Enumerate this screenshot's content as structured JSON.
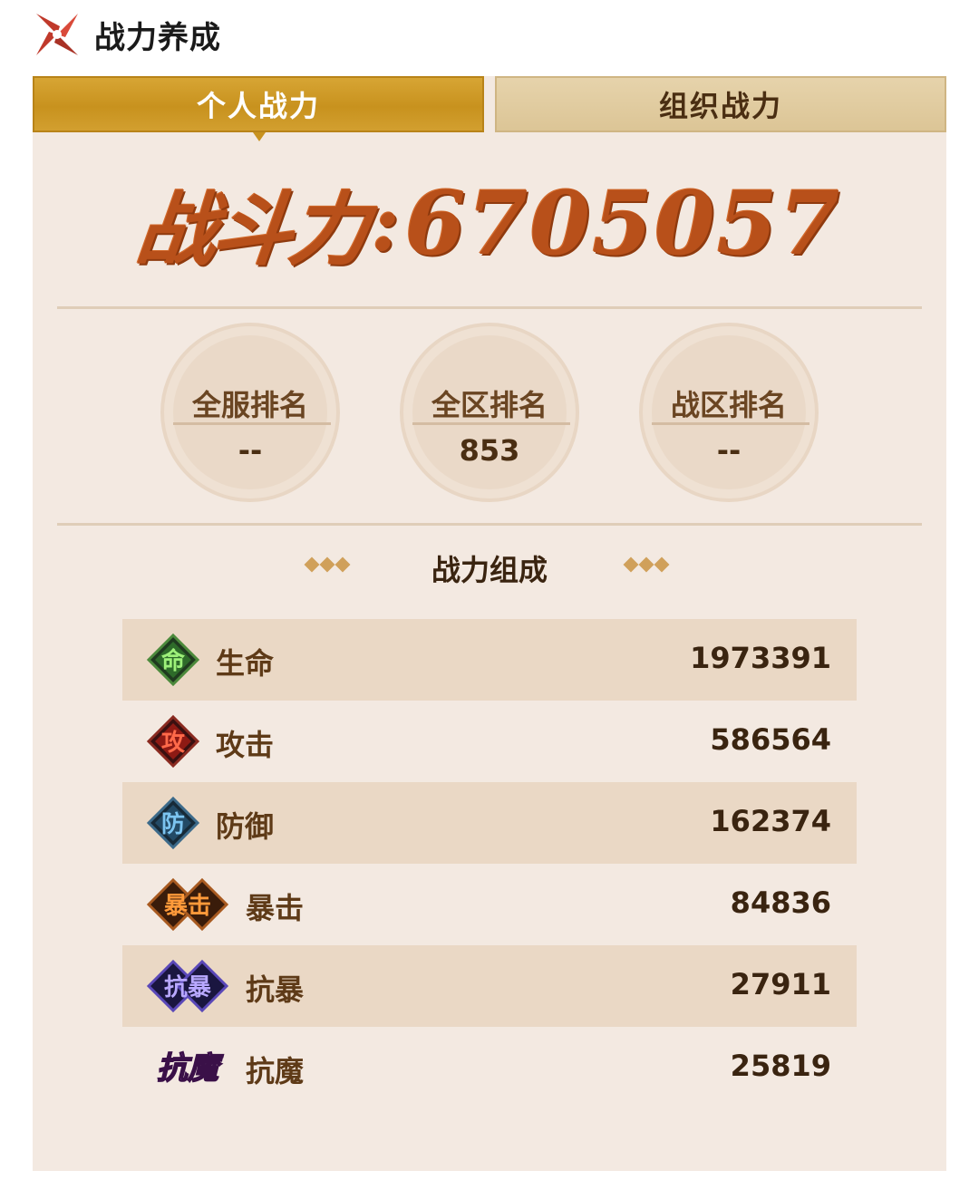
{
  "header": {
    "title": "战力养成",
    "logo_icon": "shuriken-icon"
  },
  "tabs": [
    {
      "label": "个人战力",
      "active": true
    },
    {
      "label": "组织战力",
      "active": false
    }
  ],
  "power": {
    "label": "战斗力",
    "colon": ":",
    "value": "6705057"
  },
  "ranks": [
    {
      "label": "全服排名",
      "value": "--"
    },
    {
      "label": "全区排名",
      "value": "853"
    },
    {
      "label": "战区排名",
      "value": "--"
    }
  ],
  "composition": {
    "title": "战力组成",
    "stats": [
      {
        "icon": "life-icon",
        "icon_glyph": "命",
        "icon_color": "#3a9a3a",
        "label": "生命",
        "value": "1973391"
      },
      {
        "icon": "attack-icon",
        "icon_glyph": "攻",
        "icon_color": "#b82020",
        "label": "攻击",
        "value": "586564"
      },
      {
        "icon": "defense-icon",
        "icon_glyph": "防",
        "icon_color": "#3c7fb0",
        "label": "防御",
        "value": "162374"
      },
      {
        "icon": "crit-icon",
        "icon_glyph": "暴击",
        "icon_color": "#e07a2a",
        "label": "暴击",
        "value": "84836"
      },
      {
        "icon": "anti-crit-icon",
        "icon_glyph": "抗暴",
        "icon_color": "#5a48b8",
        "label": "抗暴",
        "value": "27911"
      },
      {
        "icon": "anti-magic-icon",
        "icon_glyph": "抗魔",
        "icon_color": "#b040c8",
        "label": "抗魔",
        "value": "25819"
      }
    ]
  }
}
